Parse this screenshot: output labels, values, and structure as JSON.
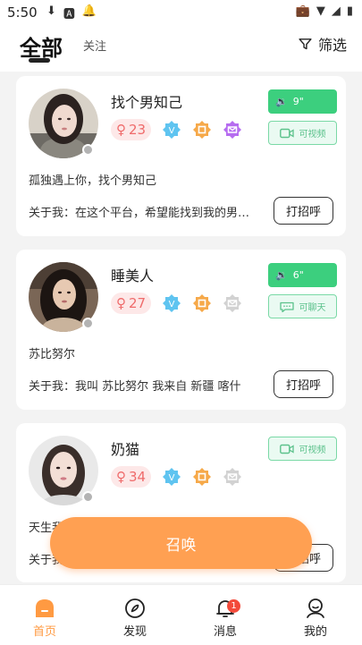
{
  "status_bar": {
    "time": "5:50"
  },
  "header": {
    "tab_all": "全部",
    "tab_follow": "关注",
    "filter_label": "筛选"
  },
  "users": [
    {
      "name": "找个男知己",
      "level": "23",
      "voice_label": "9\"",
      "chat_label": "可视频",
      "bio": "孤独遇上你，找个男知己",
      "about": "关于我：在这个平台，希望能找到我的男朋友",
      "greet_label": "打招呼"
    },
    {
      "name": "睡美人",
      "level": "27",
      "voice_label": "6\"",
      "chat_label": "可聊天",
      "bio": "苏比努尔",
      "about": "关于我：我叫 苏比努尔 我来自  新疆   喀什",
      "greet_label": "打招呼"
    },
    {
      "name": "奶猫",
      "level": "34",
      "chat_label": "可视频",
      "bio": "天生我",
      "about": "关于我",
      "greet_label": "打招呼"
    }
  ],
  "summon_label": "召唤",
  "bottom_nav": {
    "home": "首页",
    "discover": "发现",
    "messages": "消息",
    "messages_badge": "1",
    "mine": "我的"
  },
  "colors": {
    "accent": "#ff9a42",
    "voice_green": "#3ccf7e",
    "level_pink": "#ef6b6b",
    "summon_orange": "#ffa052"
  }
}
